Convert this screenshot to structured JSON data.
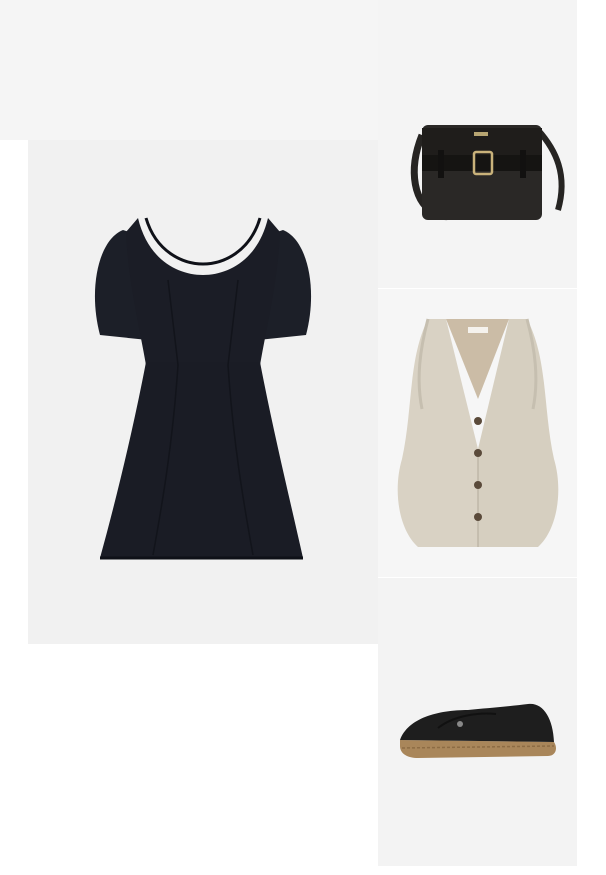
{
  "board": {
    "items": [
      {
        "name": "dress",
        "color": "#1b1d26"
      },
      {
        "name": "shoulder-bag",
        "color": "#262422"
      },
      {
        "name": "vest",
        "color": "#d9d2c4"
      },
      {
        "name": "espadrille",
        "color": "#1e1e1e"
      }
    ],
    "background": "#f3f3f3"
  }
}
